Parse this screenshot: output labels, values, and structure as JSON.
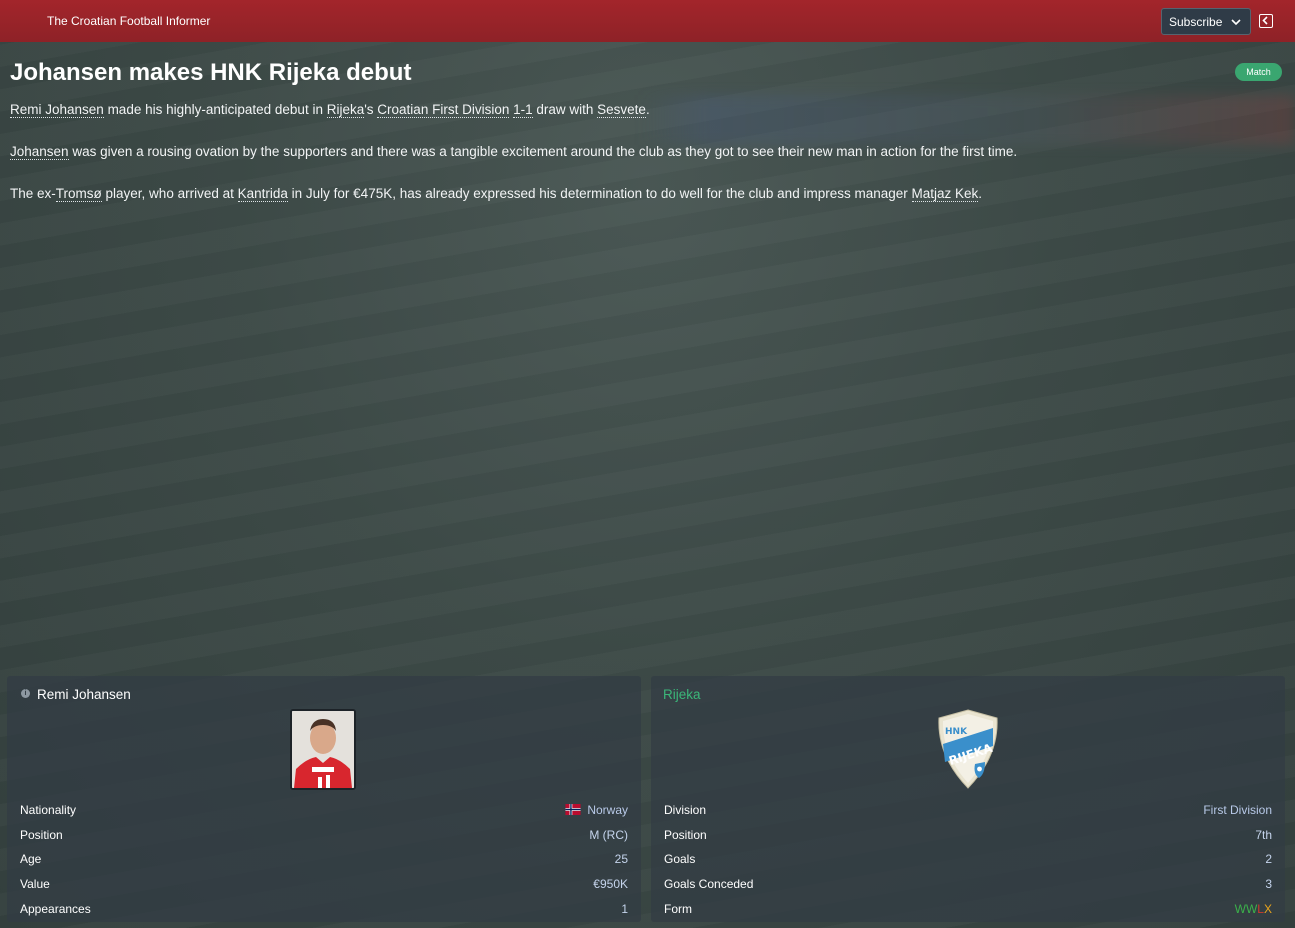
{
  "header": {
    "publication": "The Croatian Football Informer",
    "subscribe_label": "Subscribe"
  },
  "article": {
    "headline": "Johansen makes HNK Rijeka debut",
    "tag": "Match",
    "p1": {
      "a": "Remi Johansen",
      "b": " made his highly-anticipated debut in ",
      "c": "Rijeka",
      "d": "'s ",
      "e": "Croatian First Division",
      "f": " ",
      "g": "1-1",
      "h": " draw with ",
      "i": "Sesvete",
      "j": "."
    },
    "p2": {
      "a": "Johansen",
      "b": " was given a rousing ovation by the supporters and there was a tangible excitement around the club as they got to see their new man in action for the first time."
    },
    "p3": {
      "a": "The ex-",
      "b": "Tromsø",
      "c": " player, who arrived at ",
      "d": "Kantrida",
      "e": " in July for €475K, has already expressed his determination to do well for the club and impress manager ",
      "f": "Matjaz Kek",
      "g": "."
    }
  },
  "player_card": {
    "name": "Remi Johansen",
    "rows": [
      {
        "label": "Nationality",
        "value": "Norway"
      },
      {
        "label": "Position",
        "value": "M (RC)"
      },
      {
        "label": "Age",
        "value": "25"
      },
      {
        "label": "Value",
        "value": "€950K"
      },
      {
        "label": "Appearances",
        "value": "1"
      }
    ],
    "flag_icon": "norway-flag-icon"
  },
  "club_card": {
    "name": "Rijeka",
    "crest_text_top": "HNK",
    "crest_text_main": "RIJEKA",
    "rows": [
      {
        "label": "Division",
        "value": "First Division"
      },
      {
        "label": "Position",
        "value": "7th"
      },
      {
        "label": "Goals",
        "value": "2"
      },
      {
        "label": "Goals Conceded",
        "value": "3"
      },
      {
        "label": "Form",
        "value": ""
      }
    ],
    "form": {
      "w": "WW",
      "l": "L",
      "x": "X"
    }
  },
  "colors": {
    "topbar": "#9b2329",
    "tag": "#3aa670",
    "club_title": "#3bb679",
    "form_win": "#3bb14a",
    "form_loss": "#d23a2b",
    "form_draw": "#e8a41d"
  }
}
